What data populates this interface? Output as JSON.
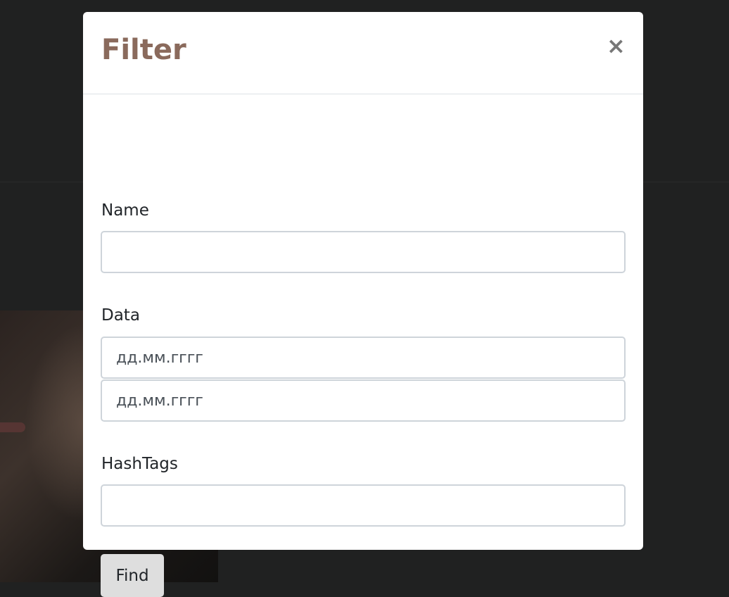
{
  "modal": {
    "title": "Filter",
    "close_symbol": "×"
  },
  "form": {
    "name": {
      "label": "Name",
      "value": ""
    },
    "data": {
      "label": "Data",
      "from_placeholder": "дд.мм.гггг",
      "to_placeholder": "дд.мм.гггг"
    },
    "hashtags": {
      "label": "HashTags",
      "value": ""
    },
    "submit_label": "Find"
  },
  "colors": {
    "title": "#8a6a5c",
    "backdrop": "#202121",
    "button_bg": "#dedede"
  }
}
